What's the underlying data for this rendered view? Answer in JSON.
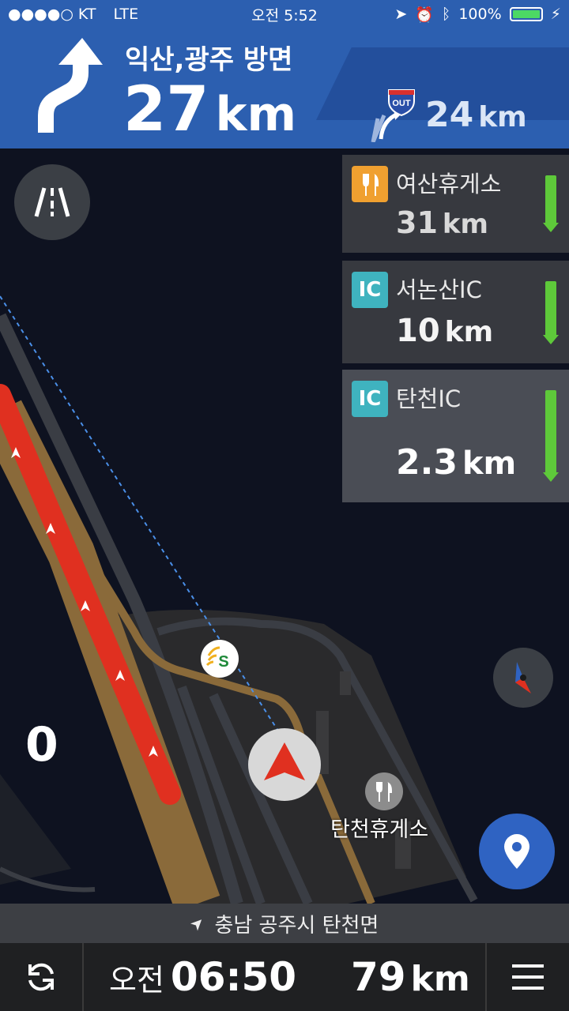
{
  "status_bar": {
    "carrier": "●●●●○ KT",
    "network": "LTE",
    "time": "오전 5:52",
    "battery": "100%"
  },
  "banner": {
    "direction": "익산,광주 방면",
    "distance_value": "27",
    "distance_unit": "km",
    "exit_badge": "OUT",
    "exit_distance_value": "24",
    "exit_distance_unit": "km"
  },
  "cards": [
    {
      "icon": "restaurant-icon",
      "badge": "",
      "name": "여산휴게소",
      "distance_value": "31",
      "distance_unit": "km",
      "color": "#f0a030"
    },
    {
      "icon": "ic-badge",
      "badge": "IC",
      "name": "서논산IC",
      "distance_value": "10",
      "distance_unit": "km",
      "color": "#3fb3bf"
    },
    {
      "icon": "ic-badge",
      "badge": "IC",
      "name": "탄천IC",
      "distance_value": "2.3",
      "distance_unit": "km",
      "color": "#3fb3bf"
    }
  ],
  "map": {
    "speed": "0",
    "poi_label": "탄천휴게소"
  },
  "road_bar": {
    "location": "충남 공주시 탄천면"
  },
  "bottom": {
    "eta_prefix": "오전",
    "eta_time": "06:50",
    "remaining_value": "79",
    "remaining_unit": "km"
  },
  "colors": {
    "banner": "#2c5fb0",
    "route_red": "#e03020",
    "road_brown": "#8a6a3a",
    "location_button": "#2f63c2"
  }
}
